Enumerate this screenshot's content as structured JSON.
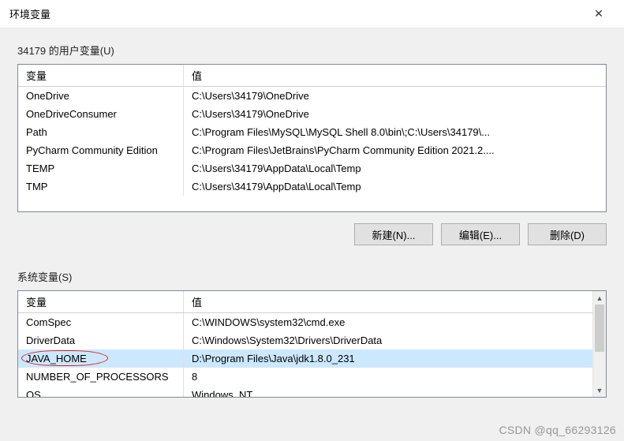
{
  "window": {
    "title": "环境变量",
    "close_glyph": "✕"
  },
  "user_vars": {
    "label": "34179 的用户变量(U)",
    "header": {
      "variable": "变量",
      "value": "值"
    },
    "rows": [
      {
        "variable": "OneDrive",
        "value": "C:\\Users\\34179\\OneDrive"
      },
      {
        "variable": "OneDriveConsumer",
        "value": "C:\\Users\\34179\\OneDrive"
      },
      {
        "variable": "Path",
        "value": "C:\\Program Files\\MySQL\\MySQL Shell 8.0\\bin\\;C:\\Users\\34179\\..."
      },
      {
        "variable": "PyCharm Community Edition",
        "value": "C:\\Program Files\\JetBrains\\PyCharm Community Edition 2021.2...."
      },
      {
        "variable": "TEMP",
        "value": "C:\\Users\\34179\\AppData\\Local\\Temp"
      },
      {
        "variable": "TMP",
        "value": "C:\\Users\\34179\\AppData\\Local\\Temp"
      }
    ]
  },
  "buttons": {
    "new": "新建(N)...",
    "edit": "编辑(E)...",
    "delete": "删除(D)"
  },
  "sys_vars": {
    "label": "系统变量(S)",
    "header": {
      "variable": "变量",
      "value": "值"
    },
    "rows": [
      {
        "variable": "ComSpec",
        "value": "C:\\WINDOWS\\system32\\cmd.exe"
      },
      {
        "variable": "DriverData",
        "value": "C:\\Windows\\System32\\Drivers\\DriverData"
      },
      {
        "variable": "JAVA_HOME",
        "value": "D:\\Program Files\\Java\\jdk1.8.0_231",
        "selected": true,
        "circled": true
      },
      {
        "variable": "NUMBER_OF_PROCESSORS",
        "value": "8"
      },
      {
        "variable": "OS",
        "value": "Windows_NT"
      }
    ]
  },
  "watermark": "CSDN @qq_66293126"
}
